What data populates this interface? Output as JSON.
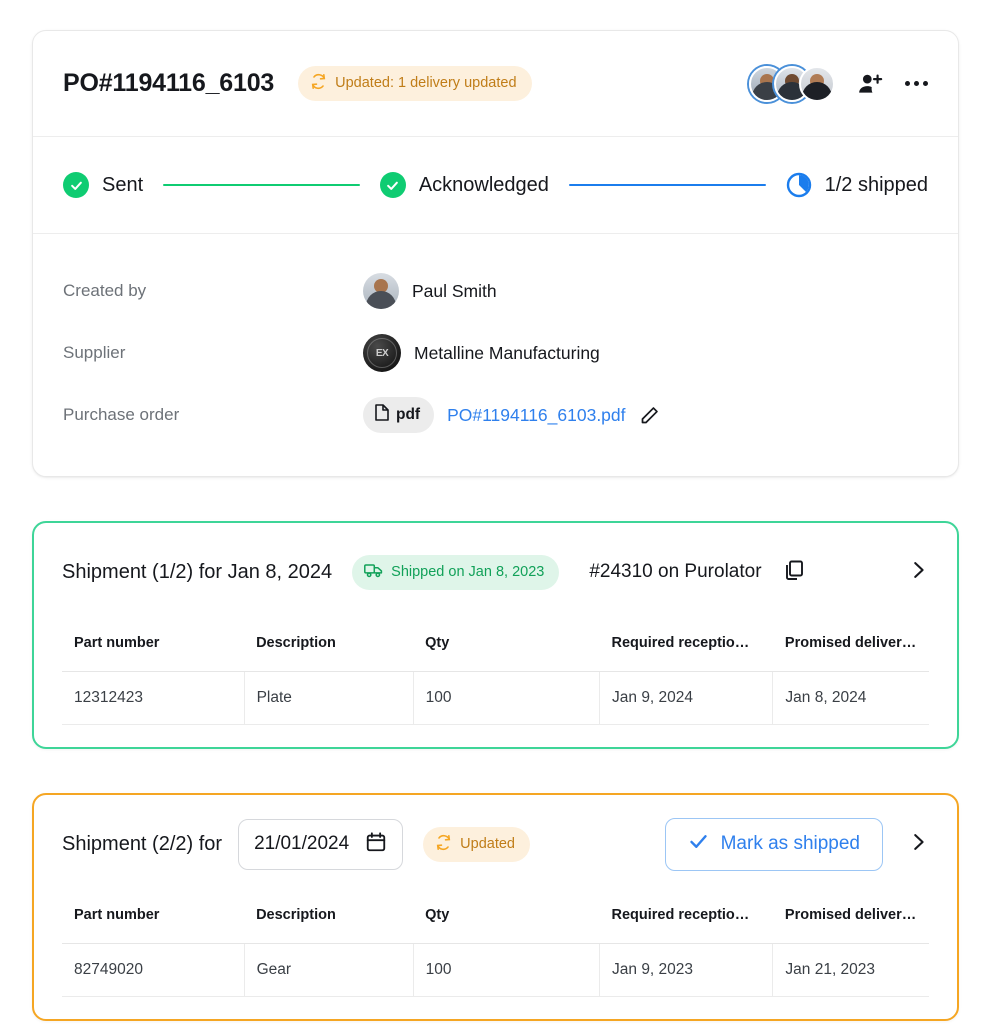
{
  "header": {
    "po_title": "PO#1194116_6103",
    "update_badge": "Updated: 1 delivery updated",
    "update_icon": "sync-icon",
    "add_person_icon": "add-person-icon",
    "more_icon": "more-options-icon",
    "avatar_count": 3
  },
  "stepper": {
    "steps": [
      {
        "label": "Sent",
        "state": "complete",
        "icon": "check-circle-icon"
      },
      {
        "label": "Acknowledged",
        "state": "complete",
        "icon": "check-circle-icon"
      },
      {
        "label": "1/2 shipped",
        "state": "in-progress",
        "icon": "pie-progress-icon"
      }
    ],
    "connector_colors": [
      "#0fcc72",
      "#1b7ded"
    ],
    "complete_color": "#0fcc72"
  },
  "details": {
    "created_by": {
      "label": "Created by",
      "value": "Paul Smith",
      "avatar": "user-avatar"
    },
    "supplier": {
      "label": "Supplier",
      "value": "Metalline Manufacturing",
      "avatar": "supplier-logo"
    },
    "purchase_order": {
      "label": "Purchase order",
      "file_type": "pdf",
      "file_name": "PO#1194116_6103.pdf",
      "edit_icon": "pencil-icon",
      "link_color": "#2f80ed"
    }
  },
  "shipments": [
    {
      "accent_color": "#3ed598",
      "title": "Shipment (1/2) for Jan 8, 2024",
      "status_badge": "Shipped on Jan 8, 2023",
      "status_icon": "truck-icon",
      "tracking": "#24310 on Purolator",
      "copy_icon": "copy-icon",
      "expand_icon": "chevron-right-icon",
      "columns": [
        "Part number",
        "Description",
        "Qty",
        "Required receptio…",
        "Promised delivery…"
      ],
      "rows": [
        [
          "12312423",
          "Plate",
          "100",
          "Jan 9, 2024",
          "Jan 8, 2024"
        ]
      ]
    },
    {
      "accent_color": "#f5a623",
      "title": "Shipment (2/2) for",
      "date_value": "21/01/2024",
      "calendar_icon": "calendar-icon",
      "status_badge": "Updated",
      "status_icon": "sync-icon",
      "action_label": "Mark as shipped",
      "action_icon": "check-icon",
      "expand_icon": "chevron-right-icon",
      "columns": [
        "Part number",
        "Description",
        "Qty",
        "Required receptio…",
        "Promised delivery…"
      ],
      "rows": [
        [
          "82749020",
          "Gear",
          "100",
          "Jan 9, 2023",
          "Jan 21, 2023"
        ]
      ]
    }
  ]
}
